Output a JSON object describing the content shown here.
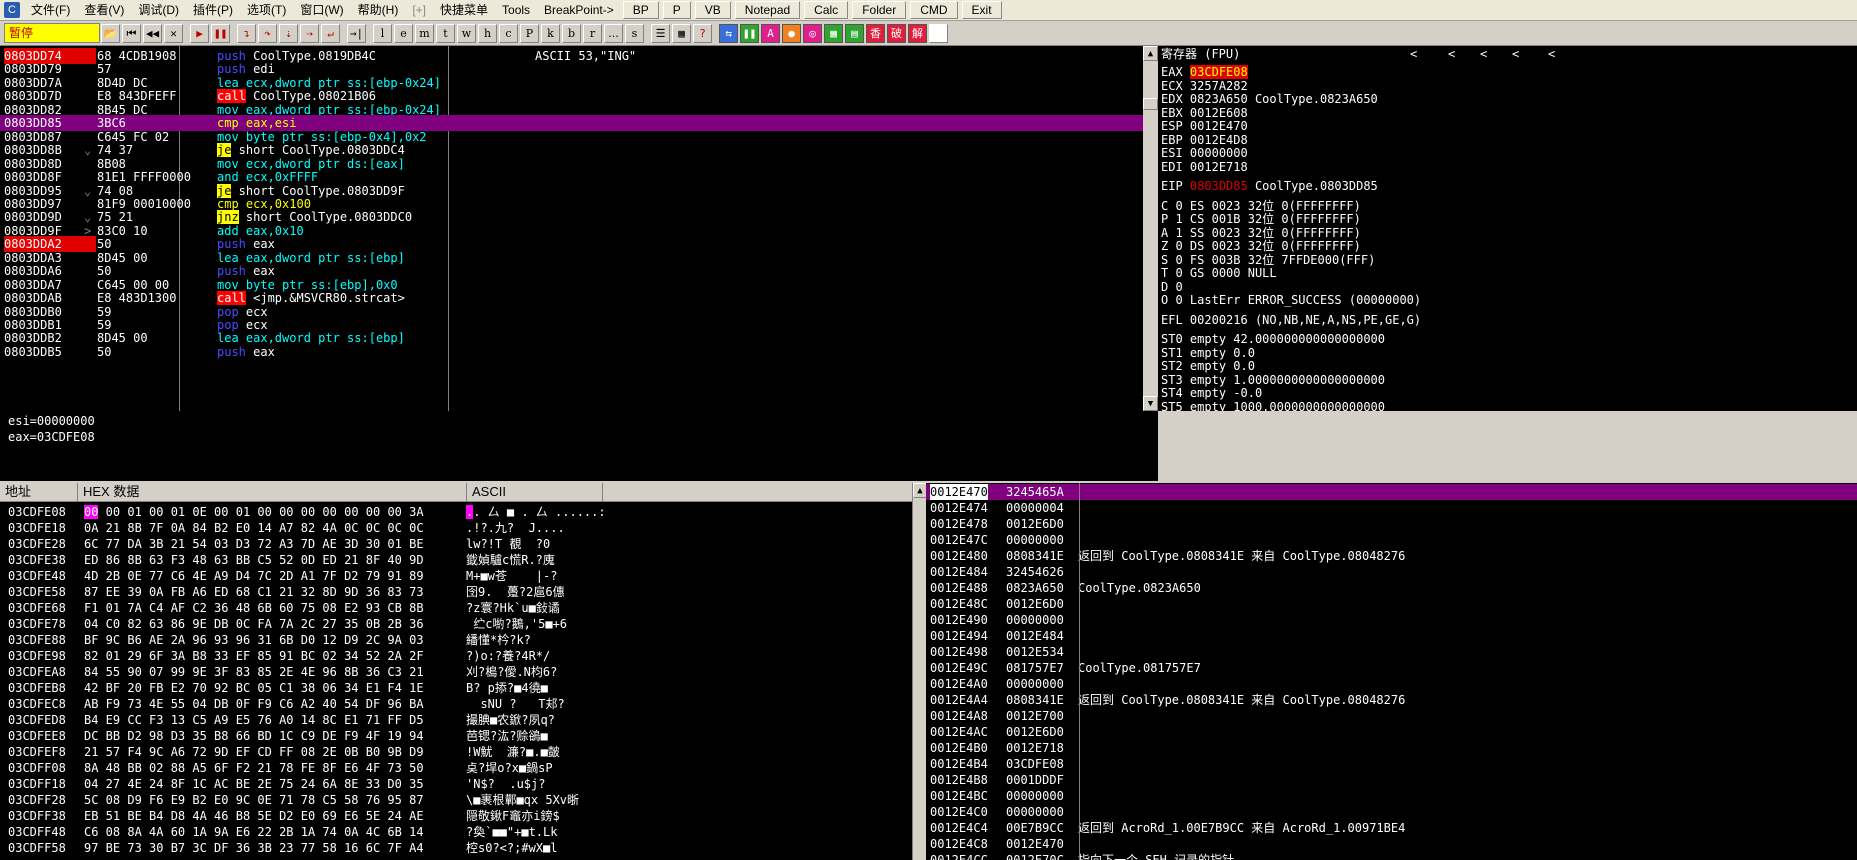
{
  "menubar": {
    "items": [
      "文件(F)",
      "查看(V)",
      "调试(D)",
      "插件(P)",
      "选项(T)",
      "窗口(W)",
      "帮助(H)",
      "[+]",
      "快捷菜单",
      "Tools",
      "BreakPoint->"
    ],
    "buttons": [
      "BP",
      "P",
      "VB",
      "Notepad",
      "Calc",
      "Folder",
      "CMD",
      "Exit"
    ]
  },
  "toolbar": {
    "status": "暂停",
    "letters": [
      "l",
      "e",
      "m",
      "t",
      "w",
      "h",
      "c",
      "P",
      "k",
      "b",
      "r",
      "...",
      "s"
    ],
    "plugins": [
      "香",
      "破",
      "解"
    ]
  },
  "disasm": {
    "rows": [
      {
        "addr": "0803DD74",
        "hex": "68 4CDB1908",
        "asm": "push CoolType.0819DB4C",
        "cmt": "ASCII 53,\"ING\"",
        "mn": "push",
        "bp": true,
        "sel": false,
        "arrow": ""
      },
      {
        "addr": "0803DD79",
        "hex": "57",
        "asm": "push edi",
        "cmt": "",
        "mn": "push",
        "bp": false,
        "sel": false,
        "arrow": ""
      },
      {
        "addr": "0803DD7A",
        "hex": "8D4D DC",
        "asm": "lea ecx,dword ptr ss:[ebp-0x24]",
        "cmt": "",
        "mn": "lea",
        "bp": false,
        "sel": false,
        "arrow": ""
      },
      {
        "addr": "0803DD7D",
        "hex": "E8 843DFEFF",
        "asm": "call CoolType.08021B06",
        "cmt": "",
        "mn": "call",
        "bp": false,
        "sel": false,
        "arrow": ""
      },
      {
        "addr": "0803DD82",
        "hex": "8B45 DC",
        "asm": "mov eax,dword ptr ss:[ebp-0x24]",
        "cmt": "",
        "mn": "mov",
        "bp": false,
        "sel": false,
        "arrow": ""
      },
      {
        "addr": "0803DD85",
        "hex": "3BC6",
        "asm": "cmp eax,esi",
        "cmt": "",
        "mn": "cmp",
        "bp": false,
        "sel": true,
        "arrow": ""
      },
      {
        "addr": "0803DD87",
        "hex": "C645 FC 02",
        "asm": "mov byte ptr ss:[ebp-0x4],0x2",
        "cmt": "",
        "mn": "mov",
        "bp": false,
        "sel": false,
        "arrow": ""
      },
      {
        "addr": "0803DD8B",
        "hex": "74 37",
        "asm": "je short CoolType.0803DDC4",
        "cmt": "",
        "mn": "je",
        "bp": false,
        "sel": false,
        "arrow": "v"
      },
      {
        "addr": "0803DD8D",
        "hex": "8B08",
        "asm": "mov ecx,dword ptr ds:[eax]",
        "cmt": "",
        "mn": "mov",
        "bp": false,
        "sel": false,
        "arrow": ""
      },
      {
        "addr": "0803DD8F",
        "hex": "81E1 FFFF0000",
        "asm": "and ecx,0xFFFF",
        "cmt": "",
        "mn": "and",
        "bp": false,
        "sel": false,
        "arrow": ""
      },
      {
        "addr": "0803DD95",
        "hex": "74 08",
        "asm": "je short CoolType.0803DD9F",
        "cmt": "",
        "mn": "je",
        "bp": false,
        "sel": false,
        "arrow": "v"
      },
      {
        "addr": "0803DD97",
        "hex": "81F9 00010000",
        "asm": "cmp ecx,0x100",
        "cmt": "",
        "mn": "cmp",
        "bp": false,
        "sel": false,
        "arrow": ""
      },
      {
        "addr": "0803DD9D",
        "hex": "75 21",
        "asm": "jnz short CoolType.0803DDC0",
        "cmt": "",
        "mn": "jnz",
        "bp": false,
        "sel": false,
        "arrow": "v"
      },
      {
        "addr": "0803DD9F",
        "hex": "83C0 10",
        "asm": "add eax,0x10",
        "cmt": "",
        "mn": "add",
        "bp": false,
        "sel": false,
        "arrow": ">"
      },
      {
        "addr": "0803DDA2",
        "hex": "50",
        "asm": "push eax",
        "cmt": "",
        "mn": "push",
        "bp": true,
        "sel": false,
        "arrow": ""
      },
      {
        "addr": "0803DDA3",
        "hex": "8D45 00",
        "asm": "lea eax,dword ptr ss:[ebp]",
        "cmt": "",
        "mn": "lea",
        "bp": false,
        "sel": false,
        "arrow": ""
      },
      {
        "addr": "0803DDA6",
        "hex": "50",
        "asm": "push eax",
        "cmt": "",
        "mn": "push",
        "bp": false,
        "sel": false,
        "arrow": ""
      },
      {
        "addr": "0803DDA7",
        "hex": "C645 00 00",
        "asm": "mov byte ptr ss:[ebp],0x0",
        "cmt": "",
        "mn": "mov",
        "bp": false,
        "sel": false,
        "arrow": ""
      },
      {
        "addr": "0803DDAB",
        "hex": "E8 483D1300",
        "asm": "call <jmp.&MSVCR80.strcat>",
        "cmt": "",
        "mn": "call",
        "bp": false,
        "sel": false,
        "arrow": ""
      },
      {
        "addr": "0803DDB0",
        "hex": "59",
        "asm": "pop ecx",
        "cmt": "",
        "mn": "pop",
        "bp": false,
        "sel": false,
        "arrow": ""
      },
      {
        "addr": "0803DDB1",
        "hex": "59",
        "asm": "pop ecx",
        "cmt": "",
        "mn": "pop",
        "bp": false,
        "sel": false,
        "arrow": ""
      },
      {
        "addr": "0803DDB2",
        "hex": "8D45 00",
        "asm": "lea eax,dword ptr ss:[ebp]",
        "cmt": "",
        "mn": "lea",
        "bp": false,
        "sel": false,
        "arrow": ""
      },
      {
        "addr": "0803DDB5",
        "hex": "50",
        "asm": "push eax",
        "cmt": "",
        "mn": "push",
        "bp": false,
        "sel": false,
        "arrow": ""
      }
    ]
  },
  "registers": {
    "title": "寄存器 (FPU)",
    "lines": [
      {
        "label": "EAX",
        "value": "03CDFE08",
        "rest": "",
        "hl": "red"
      },
      {
        "label": "ECX",
        "value": "3257A282",
        "rest": "",
        "hl": ""
      },
      {
        "label": "EDX",
        "value": "0823A650",
        "rest": "CoolType.0823A650",
        "hl": ""
      },
      {
        "label": "EBX",
        "value": "0012E608",
        "rest": "",
        "hl": ""
      },
      {
        "label": "ESP",
        "value": "0012E470",
        "rest": "",
        "hl": ""
      },
      {
        "label": "EBP",
        "value": "0012E4D8",
        "rest": "",
        "hl": ""
      },
      {
        "label": "ESI",
        "value": "00000000",
        "rest": "",
        "hl": ""
      },
      {
        "label": "EDI",
        "value": "0012E718",
        "rest": "",
        "hl": ""
      },
      {
        "label": "",
        "value": "",
        "rest": "",
        "hl": ""
      },
      {
        "label": "EIP",
        "value": "0803DD85",
        "rest": "CoolType.0803DD85",
        "hl": "eip"
      },
      {
        "label": "",
        "value": "",
        "rest": "",
        "hl": ""
      },
      {
        "label": "C 0",
        "value": "ES 0023",
        "rest": "32位 0(FFFFFFFF)",
        "hl": ""
      },
      {
        "label": "P 1",
        "value": "CS 001B",
        "rest": "32位 0(FFFFFFFF)",
        "hl": ""
      },
      {
        "label": "A 1",
        "value": "SS 0023",
        "rest": "32位 0(FFFFFFFF)",
        "hl": ""
      },
      {
        "label": "Z 0",
        "value": "DS 0023",
        "rest": "32位 0(FFFFFFFF)",
        "hl": ""
      },
      {
        "label": "S 0",
        "value": "FS 003B",
        "rest": "32位 7FFDE000(FFF)",
        "hl": ""
      },
      {
        "label": "T 0",
        "value": "GS 0000",
        "rest": "NULL",
        "hl": ""
      },
      {
        "label": "D 0",
        "value": "",
        "rest": "",
        "hl": ""
      },
      {
        "label": "O 0",
        "value": "LastErr",
        "rest": "ERROR_SUCCESS (00000000)",
        "hl": ""
      },
      {
        "label": "",
        "value": "",
        "rest": "",
        "hl": ""
      },
      {
        "label": "EFL",
        "value": "00200216",
        "rest": "(NO,NB,NE,A,NS,PE,GE,G)",
        "hl": ""
      },
      {
        "label": "",
        "value": "",
        "rest": "",
        "hl": ""
      },
      {
        "label": "ST0",
        "value": "empty",
        "rest": "42.000000000000000000",
        "hl": ""
      },
      {
        "label": "ST1",
        "value": "empty",
        "rest": "0.0",
        "hl": ""
      },
      {
        "label": "ST2",
        "value": "empty",
        "rest": "0.0",
        "hl": ""
      },
      {
        "label": "ST3",
        "value": "empty",
        "rest": "1.0000000000000000000",
        "hl": ""
      },
      {
        "label": "ST4",
        "value": "empty",
        "rest": "-0.0",
        "hl": ""
      },
      {
        "label": "ST5",
        "value": "empty",
        "rest": "1000.0000000000000000",
        "hl": ""
      }
    ]
  },
  "info": {
    "lines": [
      "esi=00000000",
      "eax=03CDFE08"
    ]
  },
  "dump": {
    "headers": [
      "地址",
      "HEX 数据",
      "ASCII"
    ],
    "rows": [
      {
        "addr": "03CDFE08",
        "hex": "00 00 01 00 01 0E 00 01 00 00 00 00 00 00 00 3A",
        "asc": ".. 厶 ■ . 厶 ......:"
      },
      {
        "addr": "03CDFE18",
        "hex": "0A 21 8B 7F 0A 84 B2 E0 14 A7 82 4A 0C 0C 0C 0C",
        "asc": ".!?.九?  J...."
      },
      {
        "addr": "03CDFE28",
        "hex": "6C 77 DA 3B 21 54 03 D3 72 A3 7D AE 3D 30 01 BE",
        "asc": "lw?!T 覩  ?0"
      },
      {
        "addr": "03CDFE38",
        "hex": "ED 86 8B 63 F3 48 63 BB C5 52 0D ED 21 8F 40 9D",
        "asc": "韱媜驢c慌R.?廆"
      },
      {
        "addr": "03CDFE48",
        "hex": "4D 2B 0E 77 C6 4E A9 D4 7C 2D A1 7F D2 79 91 89",
        "asc": "M+■w苍    |-?"
      },
      {
        "addr": "03CDFE58",
        "hex": "87 EE 39 0A FB A6 ED 68 C1 21 32 8D 9D 36 83 73",
        "asc": "囹9.  躉?2扈6僡"
      },
      {
        "addr": "03CDFE68",
        "hex": "F1 01 7A C4 AF C2 36 48 6B 60 75 08 E2 93 CB 8B",
        "asc": "?z寰?Hk`u■鈙谲"
      },
      {
        "addr": "03CDFE78",
        "hex": "04 C0 82 63 86 9E DB 0C FA 7A 2C 27 35 0B 2B 36",
        "asc": " 纻c喲?鵝,'5■+6"
      },
      {
        "addr": "03CDFE88",
        "hex": "BF 9C B6 AE 2A 96 93 96 31 6B D0 12 D9 2C 9A 03",
        "asc": "繙懂*枔?k?"
      },
      {
        "addr": "03CDFE98",
        "hex": "82 01 29 6F 3A B8 33 EF 85 91 BC 02 34 52 2A 2F",
        "asc": "?)o:?養?4R*/"
      },
      {
        "addr": "03CDFEA8",
        "hex": "84 55 90 07 99 9E 3F 83 85 2E 4E 96 8B 36 C3 21",
        "asc": "刈?槝?僾.N枃6?"
      },
      {
        "addr": "03CDFEB8",
        "hex": "42 BF 20 FB E2 70 92 BC 05 C1 38 06 34 E1 F4 1E",
        "asc": "B? p掭?■4徺■"
      },
      {
        "addr": "03CDFEC8",
        "hex": "AB F9 73 4E 55 04 DB 0F F9 C6 A2 40 54 DF 96 BA",
        "asc": "  sNU ?   T邞?"
      },
      {
        "addr": "03CDFED8",
        "hex": "B4 E9 CC F3 13 C5 A9 E5 76 A0 14 8C E1 71 FF D5",
        "asc": "撮腆■农鍁?夙q?"
      },
      {
        "addr": "03CDFEE8",
        "hex": "DC BB D2 98 D3 35 B8 66 BD 1C C9 DE F9 4F 19 94",
        "asc": "芭锶?汯?赊鵒■"
      },
      {
        "addr": "03CDFEF8",
        "hex": "21 57 F4 9C A6 72 9D EF CD FF 08 2E 0B B0 9B D9",
        "asc": "!W魷  濂?■.■皼"
      },
      {
        "addr": "03CDFF08",
        "hex": "8A 48 BB 02 88 A5 6F F2 21 78 FE 8F E6 4F 73 50",
        "asc": "奌?垾o?x■鍋sP"
      },
      {
        "addr": "03CDFF18",
        "hex": "04 27 4E 24 8F 1C AC BE 2E 75 24 6A 8E 33 D0 35",
        "asc": "'N$?  .u$j?"
      },
      {
        "addr": "03CDFF28",
        "hex": "5C 08 D9 F6 E9 B2 E0 9C 0E 71 78 C5 58 76 95 87",
        "asc": "\\■裹根鄿■qx 5Xv晣"
      },
      {
        "addr": "03CDFF38",
        "hex": "EB 51 BE B4 D8 4A 46 B8 5E D2 E0 69 E6 5E 24 AE",
        "asc": "隠敬鍬F竈亦i鎊$"
      },
      {
        "addr": "03CDFF48",
        "hex": "C6 08 8A 4A 60 1A 9A E6 22 2B 1A 74 0A 4C 6B 14",
        "asc": "?奐`■■\"+■t.Lk"
      },
      {
        "addr": "03CDFF58",
        "hex": "97 BE 73 30 B7 3C DF 36 3B 23 77 58 16 6C 7F A4",
        "asc": "椌s0?<?;#wX■l"
      }
    ]
  },
  "stack": {
    "rows": [
      {
        "addr": "0012E470",
        "val": "3245465A",
        "cmt": ""
      },
      {
        "addr": "0012E474",
        "val": "00000004",
        "cmt": ""
      },
      {
        "addr": "0012E478",
        "val": "0012E6D0",
        "cmt": ""
      },
      {
        "addr": "0012E47C",
        "val": "00000000",
        "cmt": ""
      },
      {
        "addr": "0012E480",
        "val": "0808341E",
        "cmt": "返回到 CoolType.0808341E 来自 CoolType.08048276"
      },
      {
        "addr": "0012E484",
        "val": "32454626",
        "cmt": ""
      },
      {
        "addr": "0012E488",
        "val": "0823A650",
        "cmt": "CoolType.0823A650"
      },
      {
        "addr": "0012E48C",
        "val": "0012E6D0",
        "cmt": ""
      },
      {
        "addr": "0012E490",
        "val": "00000000",
        "cmt": ""
      },
      {
        "addr": "0012E494",
        "val": "0012E484",
        "cmt": ""
      },
      {
        "addr": "0012E498",
        "val": "0012E534",
        "cmt": ""
      },
      {
        "addr": "0012E49C",
        "val": "081757E7",
        "cmt": "CoolType.081757E7"
      },
      {
        "addr": "0012E4A0",
        "val": "00000000",
        "cmt": ""
      },
      {
        "addr": "0012E4A4",
        "val": "0808341E",
        "cmt": "返回到 CoolType.0808341E 来自 CoolType.08048276"
      },
      {
        "addr": "0012E4A8",
        "val": "0012E700",
        "cmt": ""
      },
      {
        "addr": "0012E4AC",
        "val": "0012E6D0",
        "cmt": ""
      },
      {
        "addr": "0012E4B0",
        "val": "0012E718",
        "cmt": ""
      },
      {
        "addr": "0012E4B4",
        "val": "03CDFE08",
        "cmt": ""
      },
      {
        "addr": "0012E4B8",
        "val": "0001DDDF",
        "cmt": ""
      },
      {
        "addr": "0012E4BC",
        "val": "00000000",
        "cmt": ""
      },
      {
        "addr": "0012E4C0",
        "val": "00000000",
        "cmt": ""
      },
      {
        "addr": "0012E4C4",
        "val": "00E7B9CC",
        "cmt": "返回到 AcroRd_1.00E7B9CC 来自 AcroRd_1.00971BE4"
      },
      {
        "addr": "0012E4C8",
        "val": "0012E470",
        "cmt": ""
      },
      {
        "addr": "0012E4CC",
        "val": "0012E70C",
        "cmt": "指向下一个 SEH 记录的指针"
      }
    ]
  },
  "colors": {
    "breakpoint": "#e00000",
    "selection": "#800080",
    "status": "#ffff00",
    "dump_highlight": "#ff00ff"
  }
}
